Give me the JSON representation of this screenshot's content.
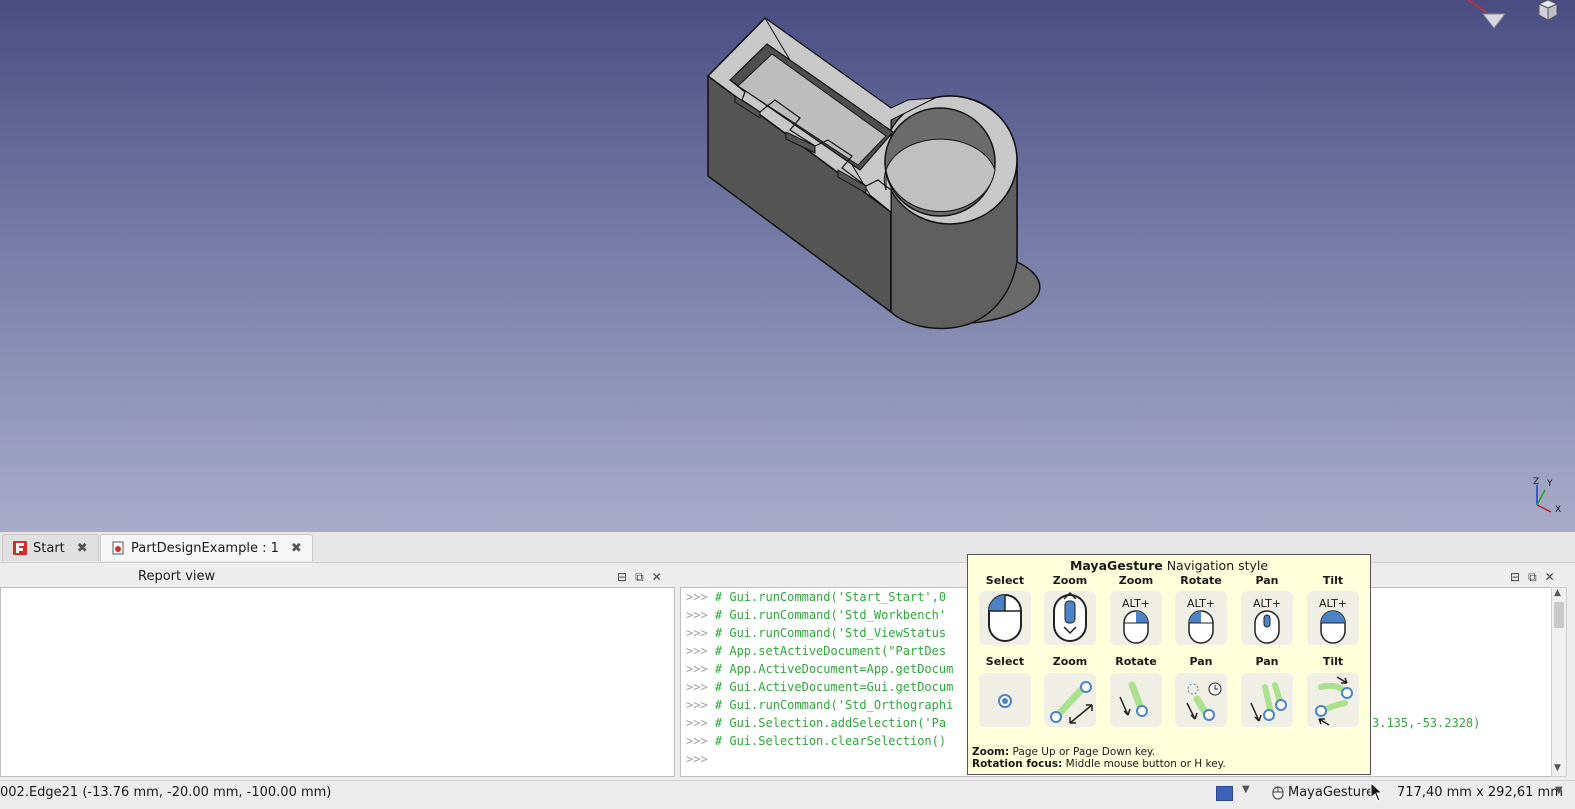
{
  "tabs": [
    {
      "label": "Start"
    },
    {
      "label": "PartDesignExample : 1"
    }
  ],
  "report_view": {
    "title": "Report view"
  },
  "console": {
    "lines": [
      ">>> # Gui.runCommand('Start_Start',0",
      ">>> # Gui.runCommand('Std_Workbench'",
      ">>> # Gui.runCommand('Std_ViewStatus",
      ">>> # App.setActiveDocument(\"PartDes",
      ">>> # App.ActiveDocument=App.getDocum",
      ">>> # Gui.ActiveDocument=Gui.getDocum",
      ">>> # Gui.runCommand('Std_Orthographi",
      ">>> # Gui.Selection.addSelection('Pa",
      ">>> # Gui.Selection.clearSelection()",
      ">>>"
    ],
    "overflow_tail": "3.135,-53.2328)"
  },
  "nav_popup": {
    "style_name": "MayaGesture",
    "title_rest": " Navigation style",
    "row1_labels": [
      "Select",
      "Zoom",
      "Zoom",
      "Rotate",
      "Pan",
      "Tilt"
    ],
    "row1_modifiers": [
      "",
      "",
      "ALT+",
      "ALT+",
      "ALT+",
      "ALT+"
    ],
    "row2_labels": [
      "Select",
      "Zoom",
      "Rotate",
      "Pan",
      "Pan",
      "Tilt"
    ],
    "hint_zoom_label": "Zoom:",
    "hint_zoom_text": " Page Up or Page Down key.",
    "hint_rotation_label": "Rotation focus:",
    "hint_rotation_text": " Middle mouse button or H key."
  },
  "status": {
    "selection_text": "002.Edge21 (-13.76 mm, -20.00 mm, -100.00 mm)",
    "nav_style": "MayaGesture",
    "dimensions": "717,40 mm x 292,61 mm"
  },
  "axis": {
    "x": "X",
    "y": "Y",
    "z": "Z"
  },
  "colors": {
    "background_top": "#4a4d82",
    "background_bottom": "#a8abc8",
    "console_comment": "#2fa83a",
    "tooltip_bg": "#ffffdc"
  }
}
